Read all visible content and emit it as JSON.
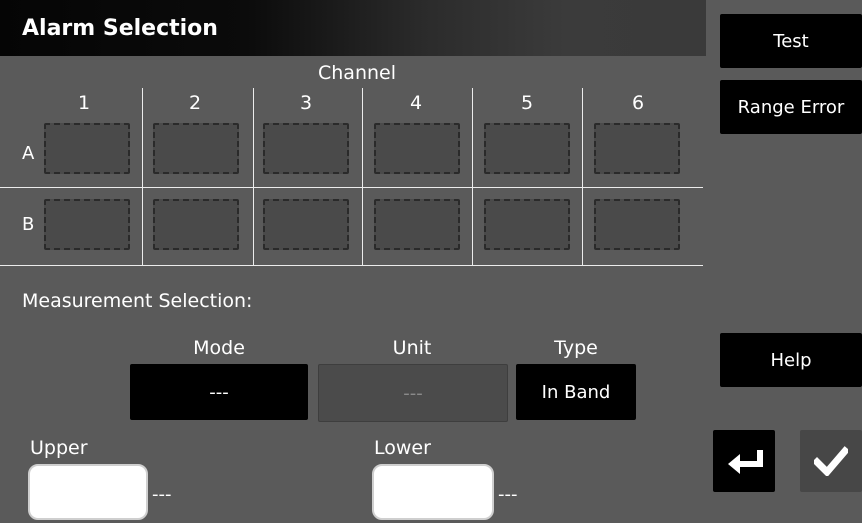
{
  "header": {
    "title": "Alarm Selection"
  },
  "grid": {
    "channel_label": "Channel",
    "columns": [
      "1",
      "2",
      "3",
      "4",
      "5",
      "6"
    ],
    "rows": [
      "A",
      "B"
    ]
  },
  "measurement": {
    "section_label": "Measurement Selection:",
    "mode": {
      "label": "Mode",
      "value": "---"
    },
    "unit": {
      "label": "Unit",
      "value": "---"
    },
    "type": {
      "label": "Type",
      "value": "In Band"
    }
  },
  "limits": {
    "upper": {
      "label": "Upper",
      "value": "",
      "suffix": "---"
    },
    "lower": {
      "label": "Lower",
      "value": "",
      "suffix": "---"
    }
  },
  "side_buttons": {
    "test": "Test",
    "range_error": "Range Error",
    "help": "Help"
  },
  "icons": {
    "back": "enter-return-icon",
    "confirm": "checkmark-icon"
  }
}
